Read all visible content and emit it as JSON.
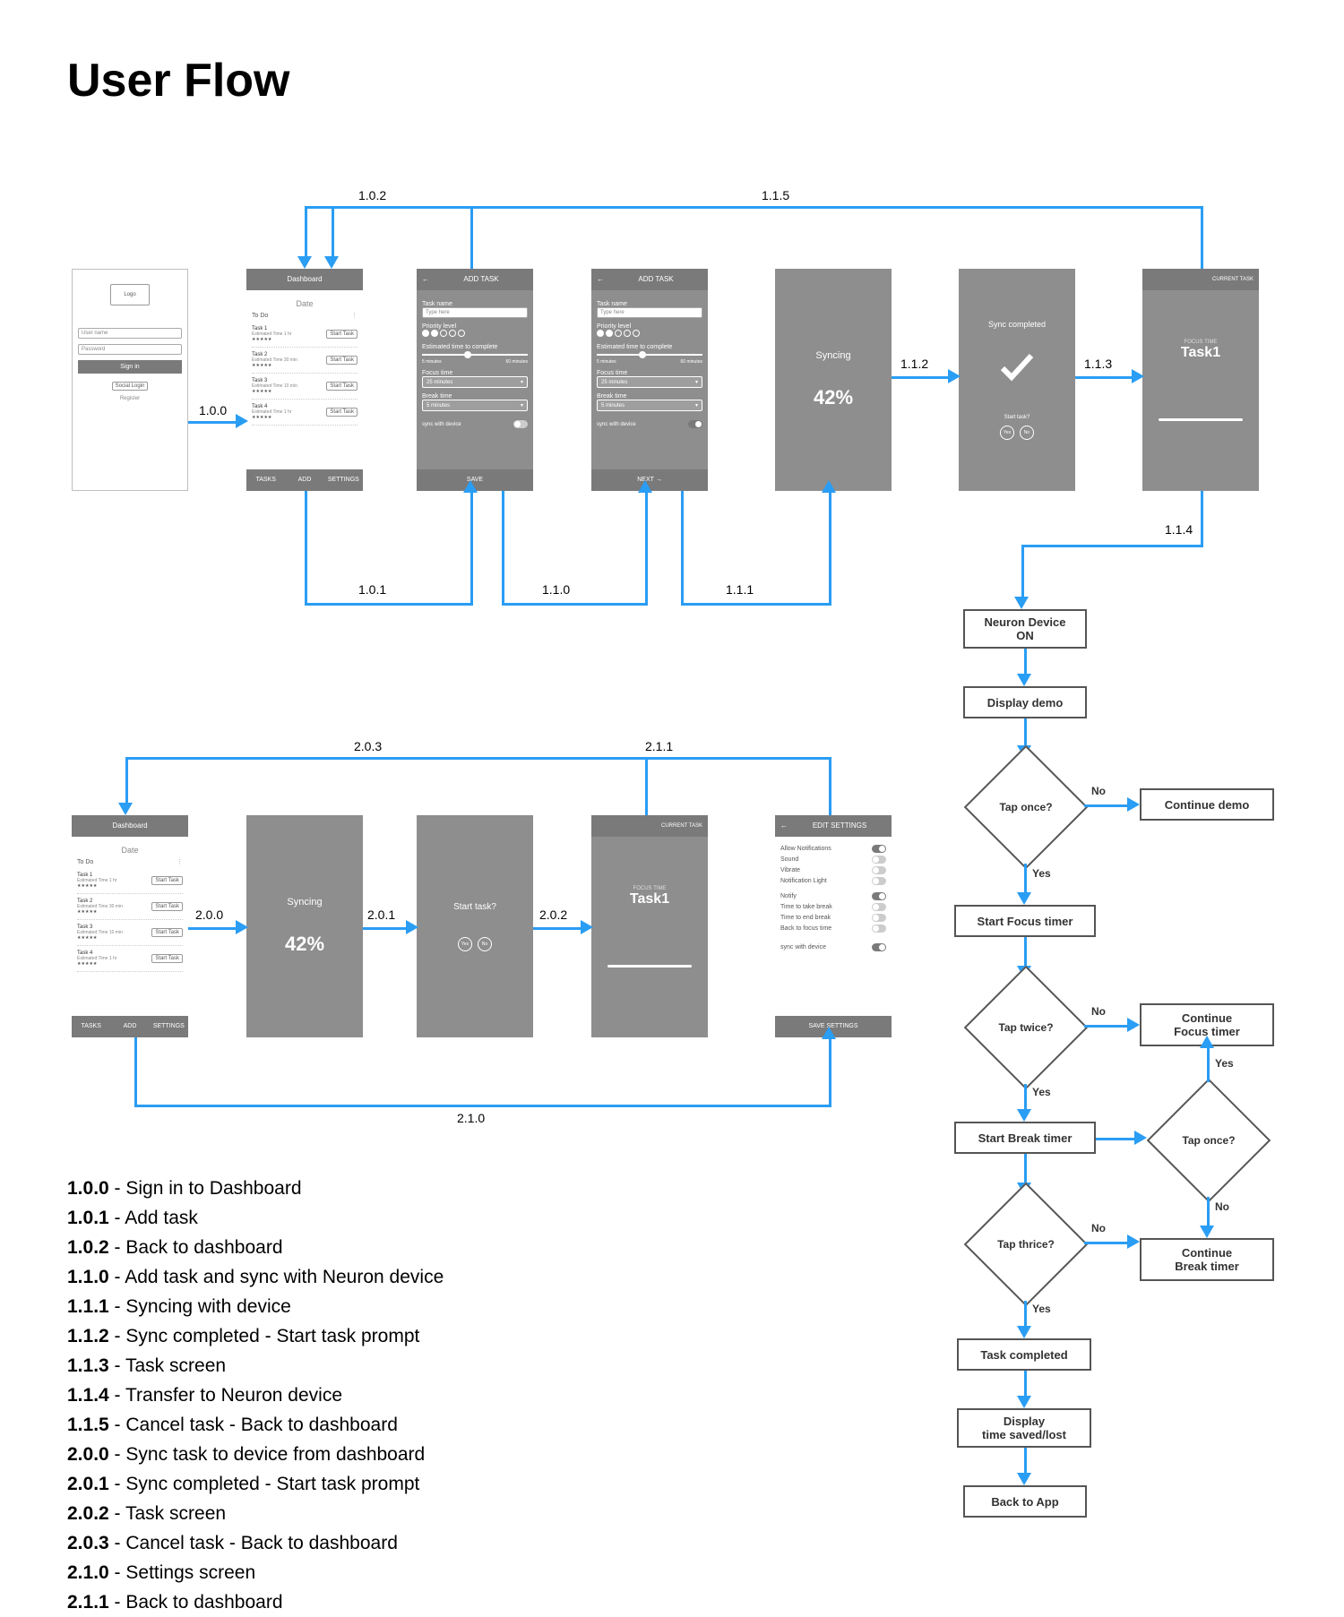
{
  "title": "User Flow",
  "arrow_labels": {
    "a100": "1.0.0",
    "a101": "1.0.1",
    "a102": "1.0.2",
    "a110": "1.1.0",
    "a111": "1.1.1",
    "a112": "1.1.2",
    "a113": "1.1.3",
    "a114": "1.1.4",
    "a115": "1.1.5",
    "a200": "2.0.0",
    "a201": "2.0.1",
    "a202": "2.0.2",
    "a203": "2.0.3",
    "a210": "2.1.0",
    "a211": "2.1.1"
  },
  "screens": {
    "login": {
      "logo": "Logo",
      "username_ph": "User name",
      "password_ph": "Password",
      "signin": "Sign in",
      "social": "Social Login",
      "register": "Register"
    },
    "dashboard": {
      "title": "Dashboard",
      "date": "Date",
      "section": "To Do",
      "tasks": [
        {
          "name": "Task 1",
          "sub": "Estimated Time 1 hr",
          "btn": "Start Task"
        },
        {
          "name": "Task 2",
          "sub": "Estimated Time 30 min",
          "btn": "Start Task"
        },
        {
          "name": "Task 3",
          "sub": "Estimated Time 10 min",
          "btn": "Start Task"
        },
        {
          "name": "Task 4",
          "sub": "Estimated Time 1 hr",
          "btn": "Start Task"
        }
      ],
      "nav": {
        "tasks": "TASKS",
        "add": "ADD",
        "settings": "SETTINGS"
      }
    },
    "add_task": {
      "title": "ADD TASK",
      "back": "←",
      "task_name_l": "Task name",
      "task_name_ph": "Type here",
      "priority_l": "Priority level",
      "est_l": "Estimated time to complete",
      "est_min": "5 minutes",
      "est_max": "60 minutes",
      "focus_l": "Focus time",
      "focus_v": "25 minutes",
      "break_l": "Break time",
      "break_v": "5 minutes",
      "sync_l": "sync with device",
      "save": "SAVE",
      "next": "NEXT  →"
    },
    "syncing": {
      "title": "Syncing",
      "pct": "42%"
    },
    "sync_done": {
      "title": "Sync completed",
      "prompt": "Start task?",
      "yes": "Yes",
      "no": "No"
    },
    "start_prompt": {
      "title": "Start task?",
      "yes": "Yes",
      "no": "No"
    },
    "current": {
      "header": "CURRENT TASK",
      "focus": "FOCUS TIME",
      "task": "Task1"
    },
    "settings": {
      "title": "EDIT SETTINGS",
      "back": "←",
      "allow": "Allow Notifications",
      "sound": "Sound",
      "vibrate": "Vibrate",
      "light": "Notification Light",
      "notify": "Notify",
      "ttb": "Time to take break",
      "teb": "Time to end break",
      "bft": "Back to focus time",
      "sync": "sync with device",
      "save": "SAVE SETTINGS"
    }
  },
  "flow": {
    "neuron_on": "Neuron Device\nON",
    "display_demo": "Display demo",
    "tap_once": "Tap once?",
    "continue_demo": "Continue demo",
    "start_focus": "Start Focus timer",
    "tap_twice": "Tap twice?",
    "continue_focus": "Continue\nFocus timer",
    "start_break": "Start Break timer",
    "tap_once2": "Tap once?",
    "tap_thrice": "Tap thrice?",
    "continue_break": "Continue\nBreak timer",
    "task_complete": "Task completed",
    "display_time": "Display\ntime saved/lost",
    "back_app": "Back to App",
    "yes": "Yes",
    "no": "No"
  },
  "legend": [
    {
      "k": "1.0.0",
      "v": " - Sign in to Dashboard"
    },
    {
      "k": "1.0.1",
      "v": " - Add task"
    },
    {
      "k": "1.0.2",
      "v": " - Back to dashboard"
    },
    {
      "k": "1.1.0",
      "v": " - Add task and sync with Neuron device"
    },
    {
      "k": "1.1.1",
      "v": " - Syncing with device"
    },
    {
      "k": "1.1.2",
      "v": " - Sync completed - Start task prompt"
    },
    {
      "k": "1.1.3",
      "v": " - Task screen"
    },
    {
      "k": "1.1.4",
      "v": " - Transfer to Neuron device"
    },
    {
      "k": "1.1.5",
      "v": " - Cancel task - Back to dashboard"
    },
    {
      "k": "2.0.0",
      "v": " - Sync task to device from dashboard"
    },
    {
      "k": "2.0.1",
      "v": " - Sync completed - Start task prompt"
    },
    {
      "k": "2.0.2",
      "v": " - Task screen"
    },
    {
      "k": "2.0.3",
      "v": " - Cancel task - Back to dashboard"
    },
    {
      "k": "2.1.0",
      "v": " - Settings screen"
    },
    {
      "k": "2.1.1",
      "v": " - Back to dashboard"
    }
  ]
}
